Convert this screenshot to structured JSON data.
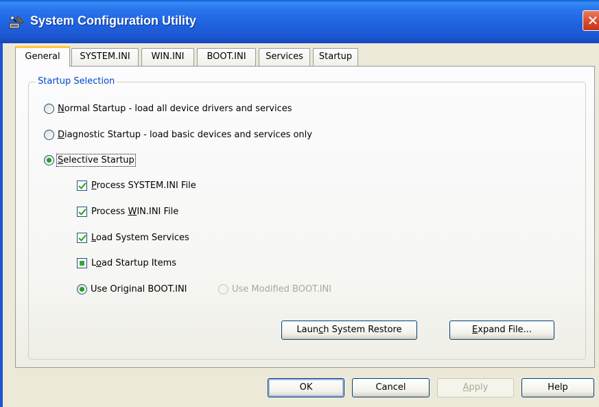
{
  "window": {
    "title": "System Configuration Utility",
    "close_glyph": "✕"
  },
  "tabs": [
    {
      "label": "General",
      "active": true
    },
    {
      "label": "SYSTEM.INI"
    },
    {
      "label": "WIN.INI"
    },
    {
      "label": "BOOT.INI"
    },
    {
      "label": "Services"
    },
    {
      "label": "Startup"
    }
  ],
  "startup_selection": {
    "title": "Startup Selection",
    "normal": {
      "key": "N",
      "rest": "ormal Startup - load all device drivers and services",
      "checked": false
    },
    "diagnostic": {
      "key": "D",
      "rest": "iagnostic Startup - load basic devices and services only",
      "checked": false
    },
    "selective": {
      "key": "S",
      "rest": "elective Startup",
      "checked": true
    },
    "options": {
      "system_ini": {
        "pre": "",
        "key": "P",
        "rest": "rocess SYSTEM.INI File",
        "state": "checked"
      },
      "win_ini": {
        "pre": "Process ",
        "key": "W",
        "rest": "IN.INI File",
        "state": "checked"
      },
      "system_services": {
        "pre": "",
        "key": "L",
        "rest": "oad System Services",
        "state": "checked"
      },
      "startup_items": {
        "pre": "L",
        "key": "o",
        "rest": "ad Startup Items",
        "state": "indeterminate"
      }
    },
    "boot": {
      "original": {
        "label": "Use Original BOOT.INI",
        "checked": true
      },
      "modified": {
        "label": "Use Modified BOOT.INI",
        "checked": false,
        "disabled": true
      }
    }
  },
  "panel_buttons": {
    "launch_restore": {
      "pre": "Laun",
      "key": "c",
      "rest": "h System Restore"
    },
    "expand_file": {
      "pre": "",
      "key": "E",
      "rest": "xpand File..."
    }
  },
  "dialog_buttons": {
    "ok": "OK",
    "cancel": "Cancel",
    "apply": {
      "key": "A",
      "rest": "pply"
    },
    "help": "Help"
  },
  "colors": {
    "titlebar": "#1f63e0",
    "group_title": "#0046d5",
    "check": "#21a121",
    "close": "#d6482a",
    "tab_highlight": "#ffc83c"
  }
}
